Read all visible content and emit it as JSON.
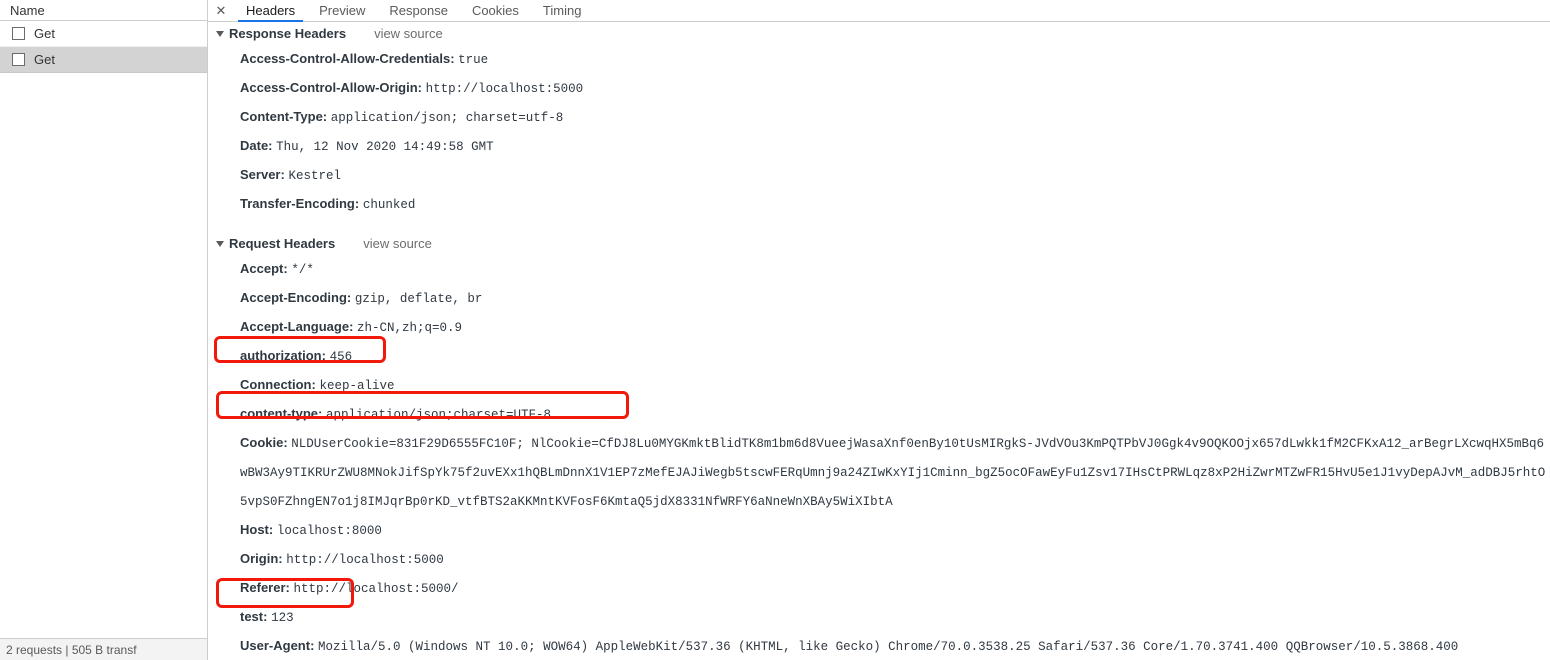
{
  "sidebar": {
    "column_header": "Name",
    "requests": [
      {
        "name": "Get",
        "selected": false
      },
      {
        "name": "Get",
        "selected": true
      }
    ],
    "status_bar": "2 requests  |  505 B transf"
  },
  "detail": {
    "close_icon": "close-icon",
    "tabs": [
      {
        "label": "Headers",
        "active": true
      },
      {
        "label": "Preview",
        "active": false
      },
      {
        "label": "Response",
        "active": false
      },
      {
        "label": "Cookies",
        "active": false
      },
      {
        "label": "Timing",
        "active": false
      }
    ],
    "response_section": {
      "title": "Response Headers",
      "view_source": "view source",
      "headers": [
        {
          "name": "Access-Control-Allow-Credentials:",
          "value": "true"
        },
        {
          "name": "Access-Control-Allow-Origin:",
          "value": "http://localhost:5000"
        },
        {
          "name": "Content-Type:",
          "value": "application/json; charset=utf-8"
        },
        {
          "name": "Date:",
          "value": "Thu, 12 Nov 2020 14:49:58 GMT"
        },
        {
          "name": "Server:",
          "value": "Kestrel"
        },
        {
          "name": "Transfer-Encoding:",
          "value": "chunked"
        }
      ]
    },
    "request_section": {
      "title": "Request Headers",
      "view_source": "view source",
      "headers": [
        {
          "name": "Accept:",
          "value": "*/*"
        },
        {
          "name": "Accept-Encoding:",
          "value": "gzip, deflate, br"
        },
        {
          "name": "Accept-Language:",
          "value": "zh-CN,zh;q=0.9"
        },
        {
          "name": "authorization:",
          "value": "456",
          "highlighted": true
        },
        {
          "name": "Connection:",
          "value": "keep-alive"
        },
        {
          "name": "content-type:",
          "value": "application/json;charset=UTF-8",
          "highlighted": true
        },
        {
          "name": "Cookie:",
          "value": "NLDUserCookie=831F29D6555FC10F; NlCookie=CfDJ8Lu0MYGKmktBlidTK8m1bm6d8VueejWasaXnf0enBy10tUsMIRgkS-JVdVOu3KmPQTPbVJ0Ggk4v9OQKOOjx657dLwkk1fM2CFKxA12_arBegrLXcwqHX5mBq6wBW3Ay9TIKRUrZWU8MNokJifSpYk75f2uvEXx1hQBLmDnnX1V1EP7zMefEJAJiWegb5tscwFERqUmnj9a24ZIwKxYIj1Cminn_bgZ5ocOFawEyFu1Zsv17IHsCtPRWLqz8xP2HiZwrMTZwFR15HvU5e1J1vyDepAJvM_adDBJ5rhtO5vpS0FZhngEN7o1j8IMJqrBp0rKD_vtfBTS2aKKMntKVFosF6KmtaQ5jdX8331NfWRFY6aNneWnXBAy5WiXIbtA"
        },
        {
          "name": "Host:",
          "value": "localhost:8000"
        },
        {
          "name": "Origin:",
          "value": "http://localhost:5000"
        },
        {
          "name": "Referer:",
          "value": "http://localhost:5000/"
        },
        {
          "name": "test:",
          "value": "123",
          "highlighted": true
        },
        {
          "name": "User-Agent:",
          "value": "Mozilla/5.0 (Windows NT 10.0; WOW64) AppleWebKit/537.36 (KHTML, like Gecko) Chrome/70.0.3538.25 Safari/537.36 Core/1.70.3741.400 QQBrowser/10.5.3868.400"
        }
      ]
    }
  },
  "colors": {
    "highlight": "#f0190a",
    "tab_active_underline": "#1a73e8",
    "selected_row": "#d3d3d3"
  }
}
